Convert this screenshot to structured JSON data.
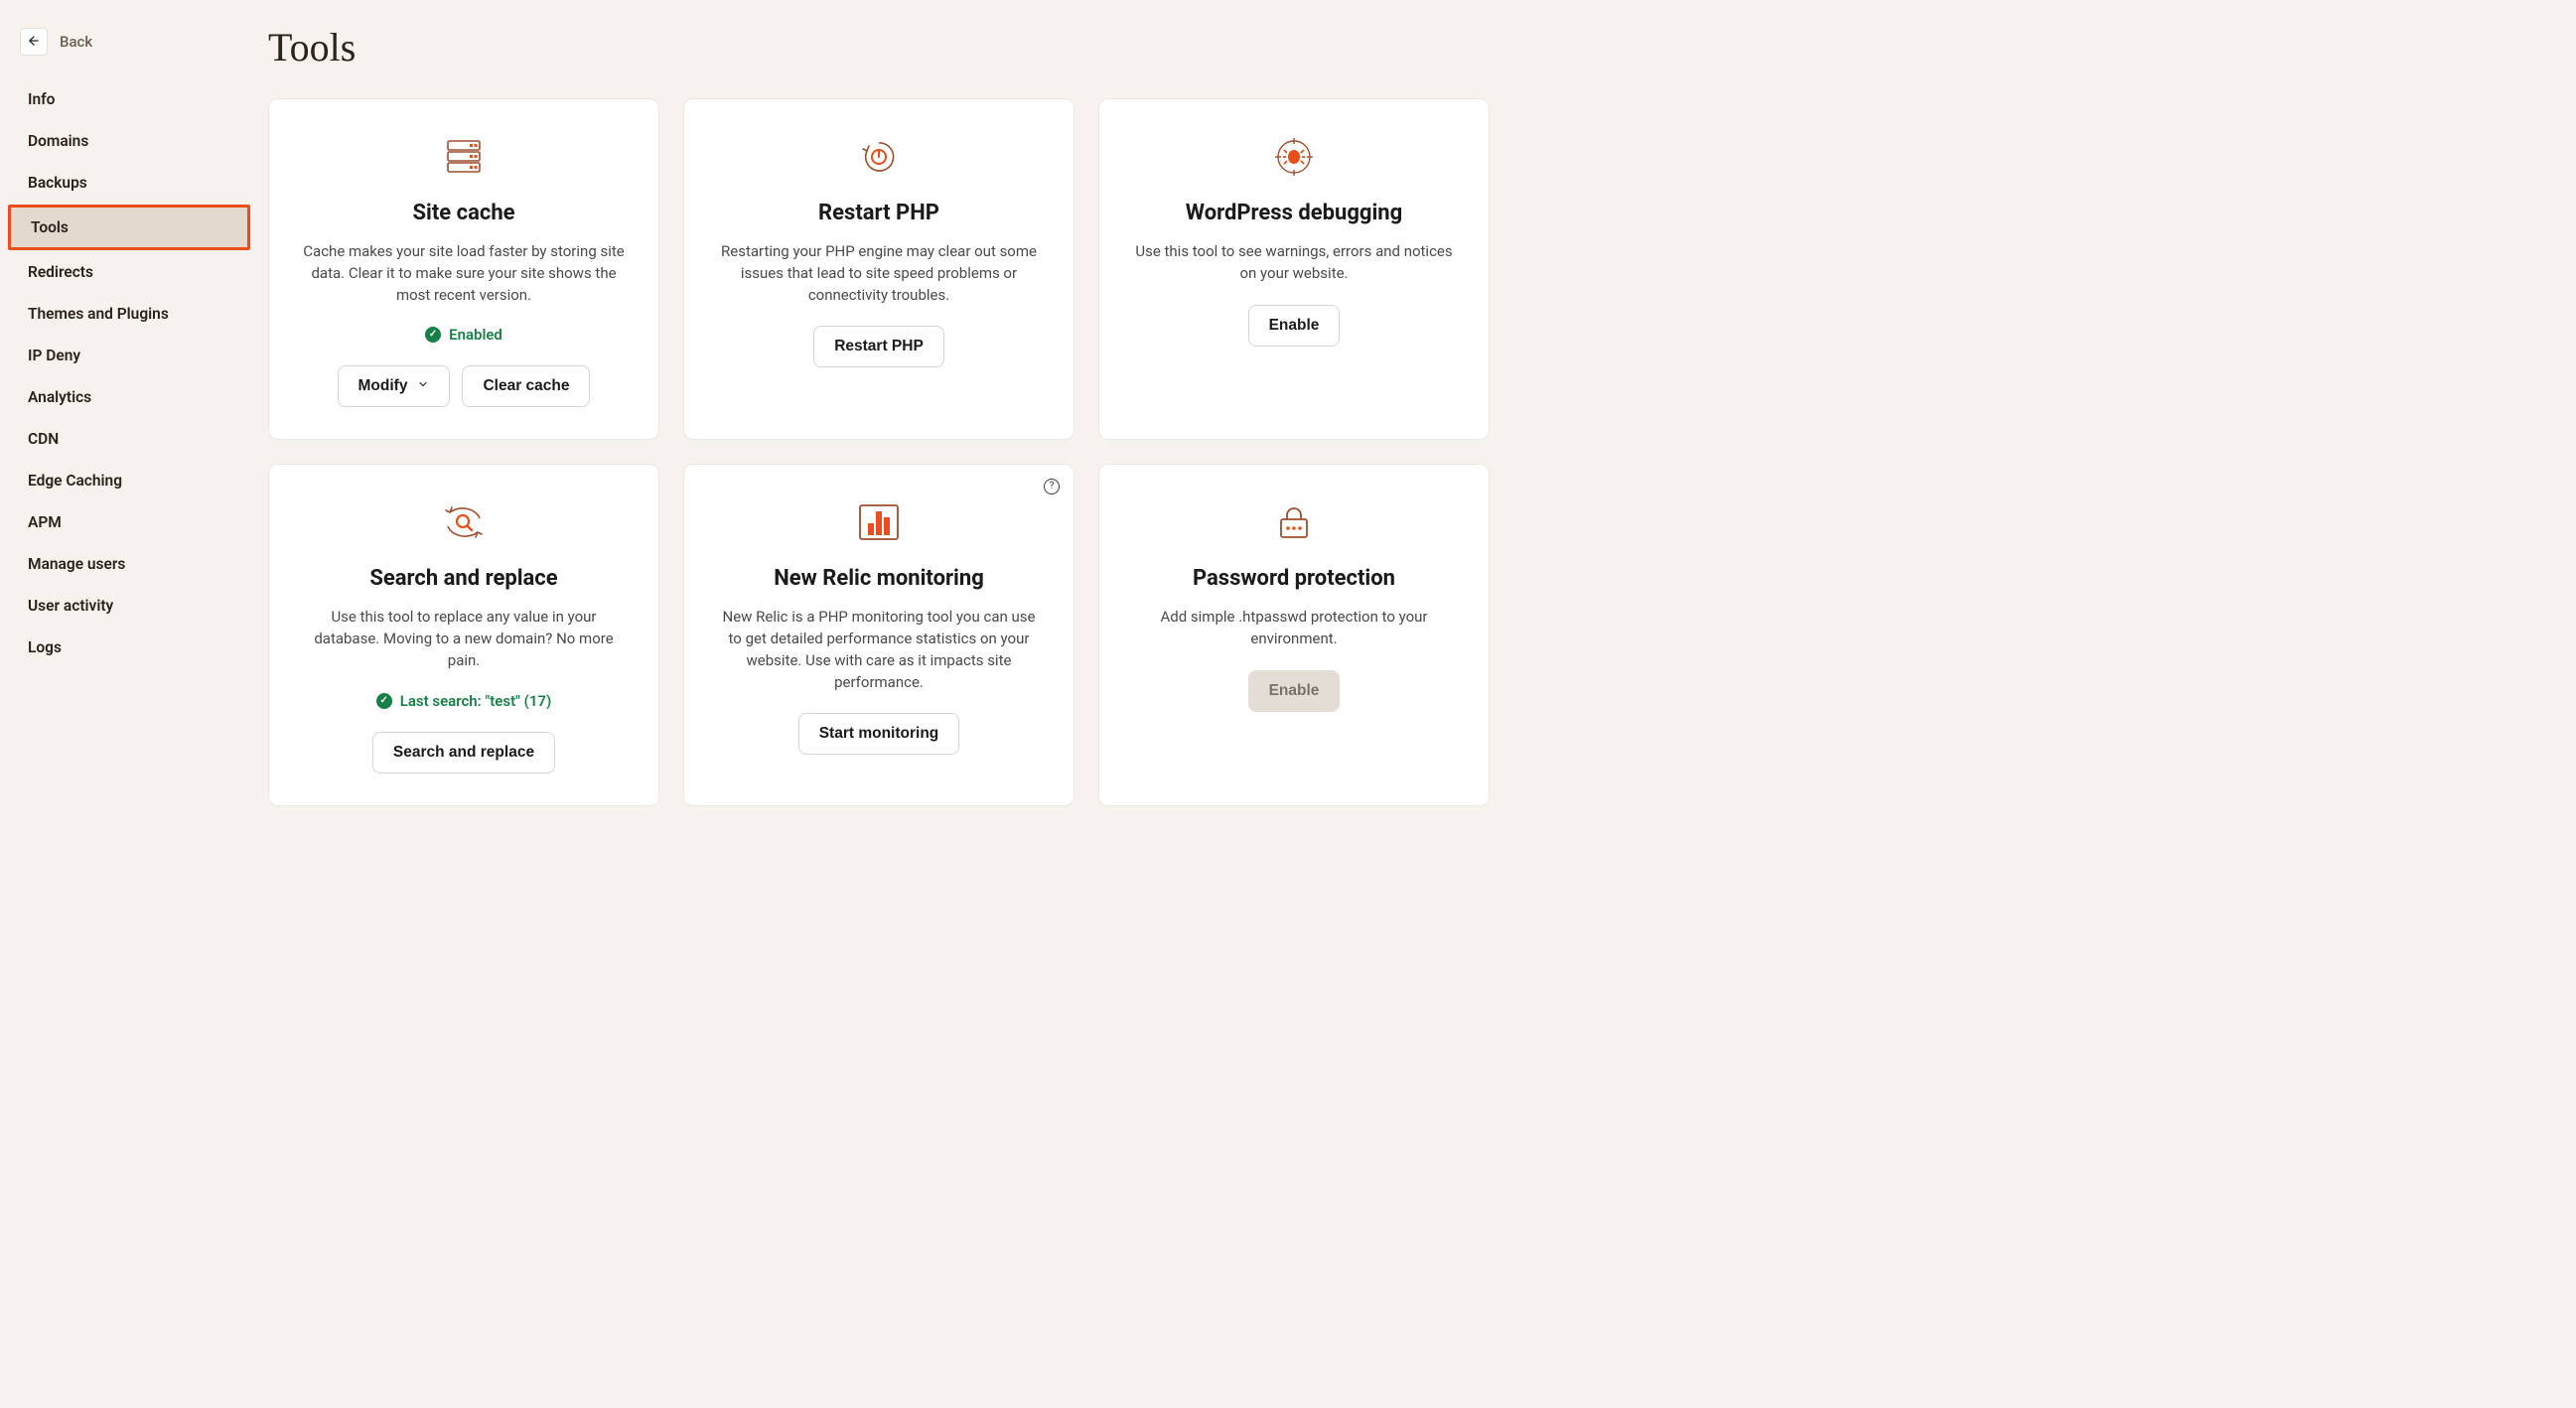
{
  "back": {
    "label": "Back"
  },
  "sidebar": {
    "items": [
      {
        "label": "Info",
        "active": false
      },
      {
        "label": "Domains",
        "active": false
      },
      {
        "label": "Backups",
        "active": false
      },
      {
        "label": "Tools",
        "active": true
      },
      {
        "label": "Redirects",
        "active": false
      },
      {
        "label": "Themes and Plugins",
        "active": false
      },
      {
        "label": "IP Deny",
        "active": false
      },
      {
        "label": "Analytics",
        "active": false
      },
      {
        "label": "CDN",
        "active": false
      },
      {
        "label": "Edge Caching",
        "active": false
      },
      {
        "label": "APM",
        "active": false
      },
      {
        "label": "Manage users",
        "active": false
      },
      {
        "label": "User activity",
        "active": false
      },
      {
        "label": "Logs",
        "active": false
      }
    ]
  },
  "page": {
    "title": "Tools"
  },
  "cards": {
    "site_cache": {
      "title": "Site cache",
      "desc": "Cache makes your site load faster by storing site data. Clear it to make sure your site shows the most recent version.",
      "status": "Enabled",
      "modify_label": "Modify",
      "clear_label": "Clear cache"
    },
    "restart_php": {
      "title": "Restart PHP",
      "desc": "Restarting your PHP engine may clear out some issues that lead to site speed problems or connectivity troubles.",
      "button": "Restart PHP"
    },
    "wp_debug": {
      "title": "WordPress debugging",
      "desc": "Use this tool to see warnings, errors and notices on your website.",
      "button": "Enable"
    },
    "search_replace": {
      "title": "Search and replace",
      "desc": "Use this tool to replace any value in your database. Moving to a new domain? No more pain.",
      "status": "Last search: \"test\" (17)",
      "button": "Search and replace"
    },
    "new_relic": {
      "title": "New Relic monitoring",
      "desc": "New Relic is a PHP monitoring tool you can use to get detailed performance statistics on your website. Use with care as it impacts site performance.",
      "button": "Start monitoring"
    },
    "password_protection": {
      "title": "Password protection",
      "desc": "Add simple .htpasswd protection to your environment.",
      "button": "Enable"
    }
  }
}
